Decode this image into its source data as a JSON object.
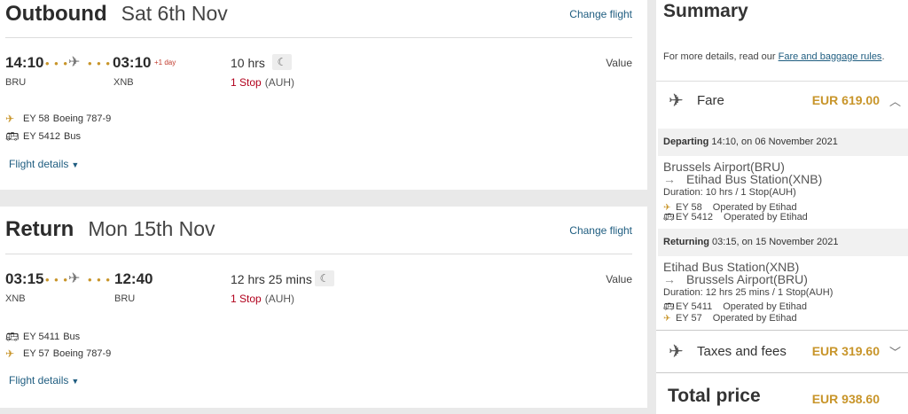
{
  "outbound": {
    "direction": "Outbound",
    "date": "Sat 6th Nov",
    "change_label": "Change flight",
    "depart_time": "14:10",
    "depart_code": "BRU",
    "arrive_time": "03:10",
    "plus_day": "+1 day",
    "arrive_code": "XNB",
    "duration": "10 hrs",
    "stops": "1 Stop",
    "via": "(AUH)",
    "fare_type": "Value",
    "segments": [
      {
        "icon": "plane-icon",
        "number": "EY 58",
        "equipment": "Boeing 787-9"
      },
      {
        "icon": "bus-icon",
        "number": "EY 5412",
        "equipment": "Bus"
      }
    ],
    "details_label": "Flight details"
  },
  "return": {
    "direction": "Return",
    "date": "Mon 15th Nov",
    "change_label": "Change flight",
    "depart_time": "03:15",
    "depart_code": "XNB",
    "arrive_time": "12:40",
    "arrive_code": "BRU",
    "duration": "12 hrs 25 mins",
    "stops": "1 Stop",
    "via": "(AUH)",
    "fare_type": "Value",
    "segments": [
      {
        "icon": "bus-icon",
        "number": "EY 5411",
        "equipment": "Bus"
      },
      {
        "icon": "plane-icon",
        "number": "EY 57",
        "equipment": "Boeing 787-9"
      }
    ],
    "details_label": "Flight details"
  },
  "summary": {
    "title": "Summary",
    "info_prefix": "For more details, read our",
    "info_link": "Fare and baggage rules",
    "info_suffix": ".",
    "fare_label": "Fare",
    "fare_amount": "EUR 619.00",
    "departing": {
      "heading_label": "Departing",
      "heading_detail": "14:10, on 06 November 2021",
      "from": "Brussels Airport(BRU)",
      "to": "Etihad Bus Station(XNB)",
      "duration": "Duration: 10 hrs  / 1 Stop(AUH)",
      "segments": [
        {
          "icon": "plane-icon",
          "number": "EY 58",
          "operator": "Operated by Etihad"
        },
        {
          "icon": "bus-icon",
          "number": "EY 5412",
          "operator": "Operated by Etihad"
        }
      ]
    },
    "returning": {
      "heading_label": "Returning",
      "heading_detail": "03:15, on 15 November 2021",
      "from": "Etihad Bus Station(XNB)",
      "to": "Brussels Airport(BRU)",
      "duration": "Duration: 12 hrs 25 mins  / 1 Stop(AUH)",
      "segments": [
        {
          "icon": "bus-icon",
          "number": "EY 5411",
          "operator": "Operated by Etihad"
        },
        {
          "icon": "plane-icon",
          "number": "EY 57",
          "operator": "Operated by Etihad"
        }
      ]
    },
    "taxes_label": "Taxes and fees",
    "taxes_amount": "EUR 319.60",
    "total_label": "Total price",
    "total_amount": "EUR 938.60"
  },
  "colors": {
    "accent": "#c8952a",
    "link": "#1f5d80",
    "stop_red": "#b1001c"
  }
}
